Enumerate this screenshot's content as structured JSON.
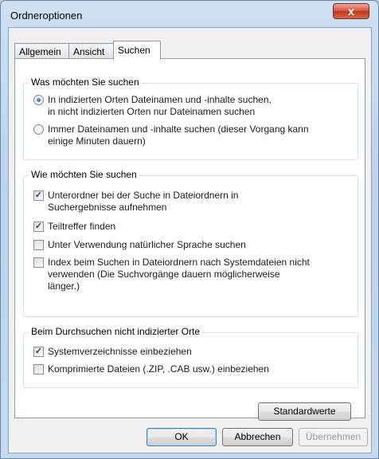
{
  "window": {
    "title": "Ordneroptionen",
    "close_label": "x"
  },
  "tabs": [
    {
      "label": "Allgemein"
    },
    {
      "label": "Ansicht"
    },
    {
      "label": "Suchen"
    }
  ],
  "what_group": {
    "legend": "Was möchten Sie suchen",
    "options": [
      {
        "line1": "In indizierten Orten Dateinamen und -inhalte suchen,",
        "line2": "in nicht indizierten Orten nur Dateinamen suchen",
        "checked": true
      },
      {
        "line1": "Immer Dateinamen und -inhalte suchen (dieser Vorgang kann",
        "line2": "einige Minuten dauern)",
        "checked": false
      }
    ]
  },
  "how_group": {
    "legend": "Wie möchten Sie suchen",
    "options": [
      {
        "line1": "Unterordner bei der Suche in Dateiordnern in",
        "line2": "Suchergebnisse aufnehmen",
        "checked": true
      },
      {
        "line1": "Teiltreffer finden",
        "checked": true
      },
      {
        "line1": "Unter Verwendung natürlicher Sprache suchen",
        "checked": false
      },
      {
        "line1": "Index beim Suchen in Dateiordnern nach Systemdateien nicht",
        "line2": "verwenden (Die Suchvorgänge dauern möglicherweise",
        "line3": "länger.)",
        "checked": false
      }
    ]
  },
  "nonindexed_group": {
    "legend": "Beim Durchsuchen nicht indizierter Orte",
    "options": [
      {
        "line1": "Systemverzeichnisse einbeziehen",
        "checked": true
      },
      {
        "line1": "Komprimierte Dateien (.ZIP, .CAB usw.) einbeziehen",
        "checked": false
      }
    ]
  },
  "buttons": {
    "restore_defaults": "Standardwerte",
    "ok": "OK",
    "cancel": "Abbrechen",
    "apply": "Übernehmen"
  },
  "check_glyph": "✓"
}
